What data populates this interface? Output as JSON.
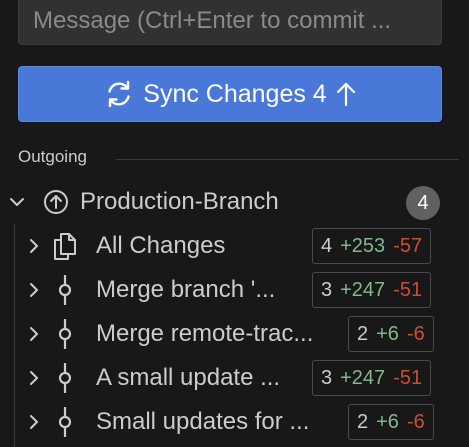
{
  "message_input": {
    "placeholder": "Message (Ctrl+Enter to commit ..."
  },
  "sync_button": {
    "label": "Sync Changes 4",
    "icons": [
      "sync-icon",
      "arrow-up-icon"
    ]
  },
  "section": {
    "label": "Outgoing"
  },
  "branch": {
    "name": "Production-Branch",
    "count": "4",
    "icons": [
      "chevron-down-icon",
      "outgoing-arrow-circle-icon"
    ]
  },
  "commits": [
    {
      "label": "All Changes",
      "files": "4",
      "added": "+253",
      "removed": "-57",
      "icon": "files-icon"
    },
    {
      "label": "Merge branch '...",
      "files": "3",
      "added": "+247",
      "removed": "-51",
      "icon": "git-commit-icon"
    },
    {
      "label": "Merge remote-trac...",
      "files": "2",
      "added": "+6",
      "removed": "-6",
      "icon": "git-commit-icon"
    },
    {
      "label": "A small update ...",
      "files": "3",
      "added": "+247",
      "removed": "-51",
      "icon": "git-commit-icon"
    },
    {
      "label": "Small updates for ...",
      "files": "2",
      "added": "+6",
      "removed": "-6",
      "icon": "git-commit-icon"
    }
  ],
  "colors": {
    "background": "#181818",
    "button": "#4a78d8",
    "added": "#81b88b",
    "removed": "#c74e39",
    "badge": "#616161"
  }
}
